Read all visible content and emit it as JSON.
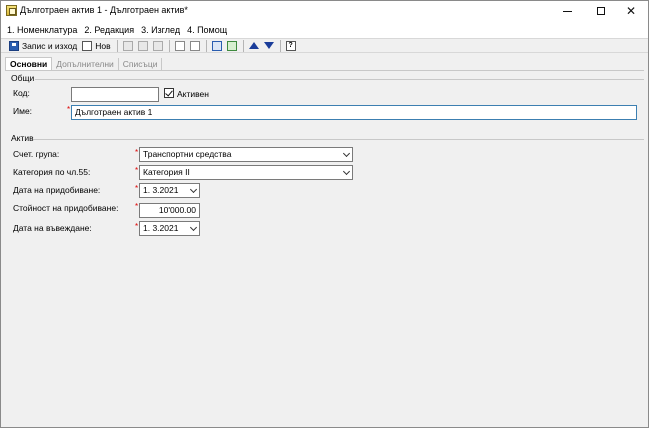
{
  "window": {
    "title": "Дълготраен актив 1 - Дълготраен актив*"
  },
  "menu": [
    "1. Номенклатура",
    "2. Редакция",
    "3. Изглед",
    "4. Помощ"
  ],
  "toolbar": {
    "save_label": "Запис и изход",
    "new_label": "Нов"
  },
  "tabs": [
    "Основни",
    "Допълнителни",
    "Списъци"
  ],
  "general": {
    "title": "Общи",
    "code_label": "Код:",
    "code_value": "",
    "active_label": "Активен",
    "active_checked": true,
    "name_label": "Име:",
    "name_value": "Дълготраен актив 1"
  },
  "asset": {
    "title": "Актив",
    "account_group_label": "Счет. група:",
    "account_group_value": "Транспортни средства",
    "category_label": "Категория по чл.55:",
    "category_value": "Категория II",
    "acquisition_date_label": "Дата на придобиване:",
    "acquisition_date_value": "1.  3.2021",
    "acquisition_value_label": "Стойност на придобиване:",
    "acquisition_value_value": "10'000.00",
    "commission_date_label": "Дата на въвеждане:",
    "commission_date_value": "1.  3.2021"
  },
  "colors": {
    "required_marker": "#dd0000",
    "focus_border": "#3c7fb1",
    "arrow_blue": "#1a3d9a"
  }
}
